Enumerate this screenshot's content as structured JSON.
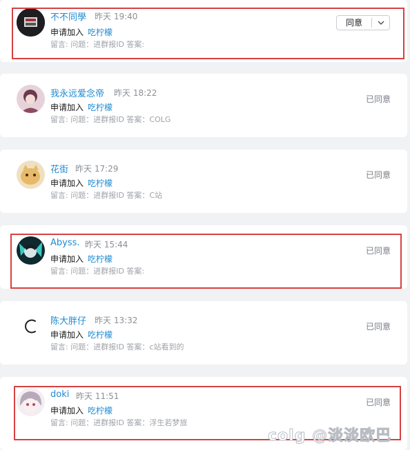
{
  "requests": [
    {
      "name": "不不同學",
      "time": "昨天 19:40",
      "action": "申请加入",
      "group": "吃柠檬",
      "detail": "留言: 问题：进群报ID 答案:",
      "status": "",
      "button_label": "同意"
    },
    {
      "name": "我永远爱念帝",
      "time": "昨天 18:22",
      "action": "申请加入",
      "group": "吃柠檬",
      "detail": "留言: 问题：进群报ID 答案：COLG",
      "status": "已同意"
    },
    {
      "name": "花街",
      "time": "昨天 17:29",
      "action": "申请加入",
      "group": "吃柠檬",
      "detail": "留言: 问题：进群报ID 答案：C站",
      "status": "已同意"
    },
    {
      "name": "Abyss.",
      "time": "昨天 15:44",
      "action": "申请加入",
      "group": "吃柠檬",
      "detail": "留言: 问题：进群报ID 答案:",
      "status": "已同意"
    },
    {
      "name": "陈大胖仔",
      "time": "昨天 13:32",
      "action": "申请加入",
      "group": "吃柠檬",
      "detail": "留言: 问题：进群报ID 答案：c站看到的",
      "status": "已同意"
    },
    {
      "name": "doki",
      "time": "昨天 11:51",
      "action": "申请加入",
      "group": "吃柠檬",
      "detail": "留言: 问题：进群报ID 答案：浮生若梦旅",
      "status": "已同意"
    }
  ],
  "watermark": "colg @淡淡欧巴",
  "colors": {
    "link": "#1f8ad2",
    "highlight": "#d64040",
    "background": "#f1f2f4"
  }
}
